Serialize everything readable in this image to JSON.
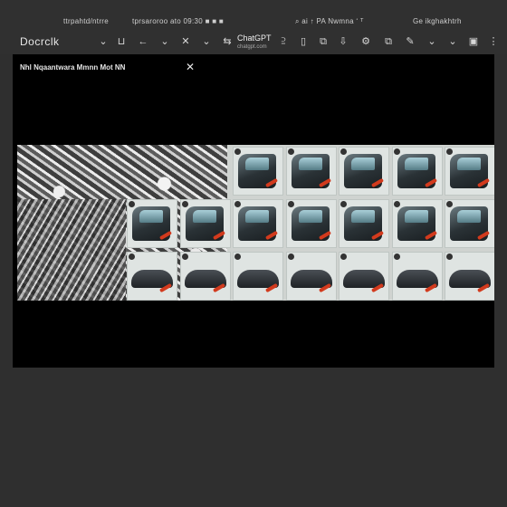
{
  "statusbar": {
    "left_text": "ttrpahtd/ntrre",
    "center_text": "tprsaroroo ato 09:30 ■ ■ ■",
    "right_text": "⌕ ai ↑ PA Nwmna ʻ ᵀ",
    "far_right_text": "Gе ikghakhtrh"
  },
  "toolbar": {
    "brand": "Docrclk",
    "site_title": "ChatGPT",
    "site_url": "chatgpt.com",
    "icons": [
      "chevron-down-icon",
      "bookmark-icon",
      "chevron-down-icon",
      "close-icon",
      "chevron-down-icon",
      "swap-icon",
      "share-icon",
      "bookmark-icon",
      "copy-icon",
      "download-icon",
      "settings-icon",
      "copy-icon",
      "edit-icon",
      "chevron-down-icon",
      "expand-icon",
      "more-icon"
    ]
  },
  "viewer": {
    "title": "Nhl Nqaantwara Mmnn  Mot  NN",
    "close_label": "✕"
  },
  "image": {
    "description_icon": "car-door-repair-steps-image",
    "panel_count": 24
  }
}
